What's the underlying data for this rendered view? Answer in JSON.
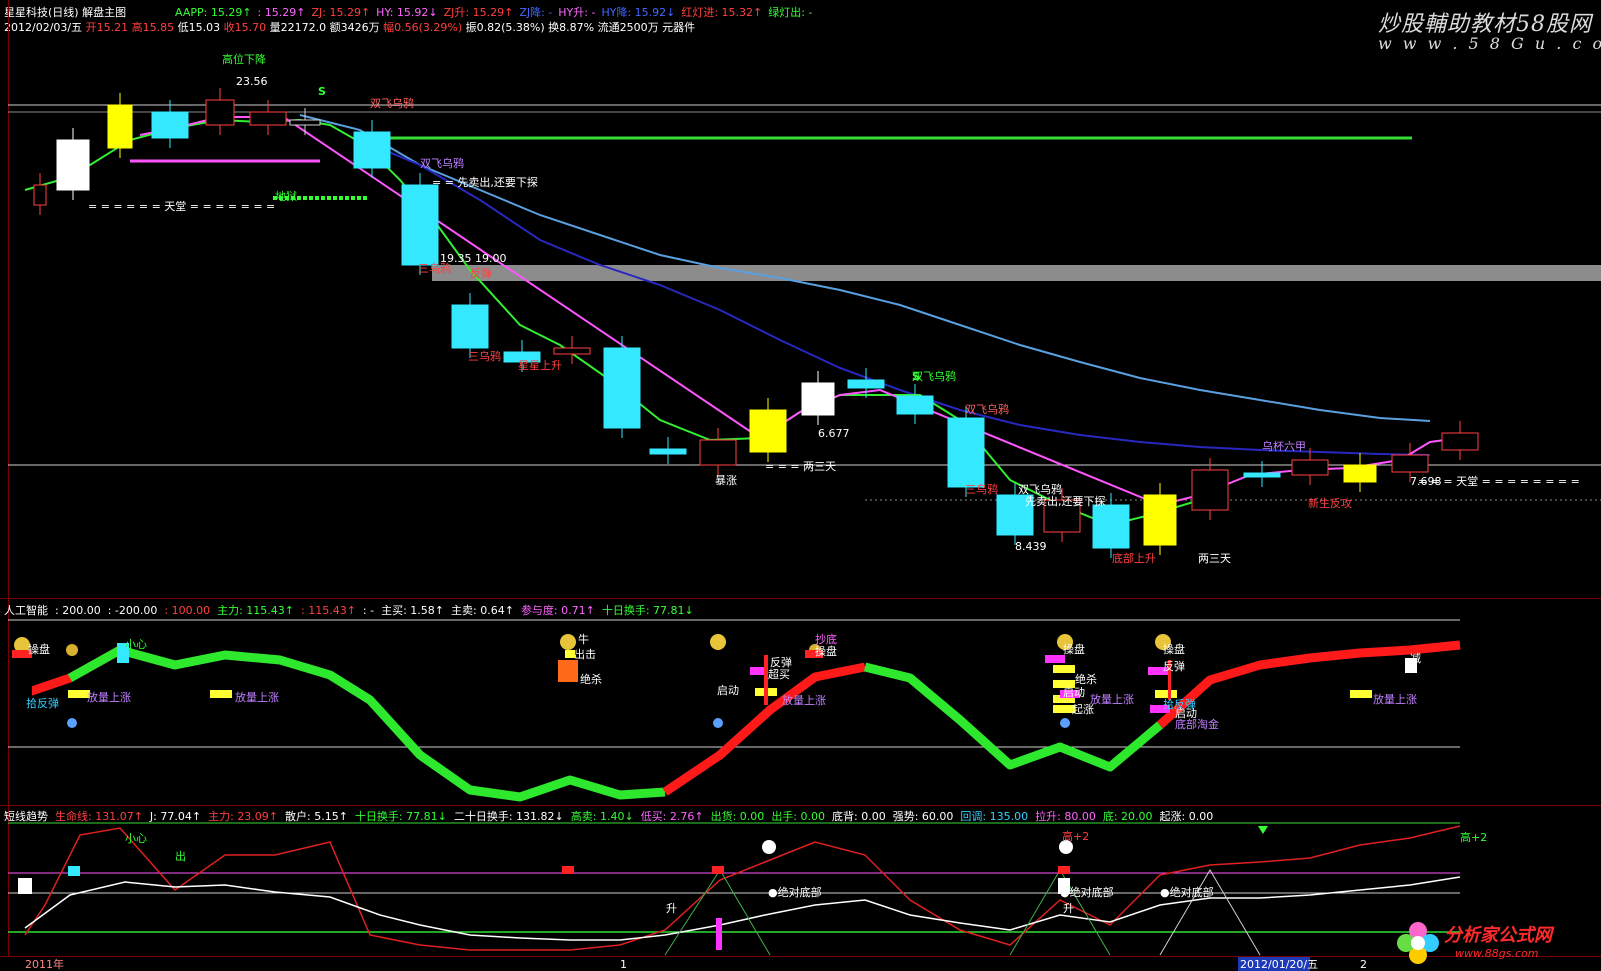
{
  "header": {
    "title": "星星科技(日线)",
    "subtitle": "解盘主图",
    "indicators1": [
      {
        "label": "AAPP: 15.29",
        "arrow": "↑",
        "color": "#33ff33"
      },
      {
        "label": ": 15.29",
        "arrow": "↑",
        "color": "#ff66ff"
      },
      {
        "label": "ZJ: 15.29",
        "arrow": "↑",
        "color": "#ff4040"
      },
      {
        "label": "HY: 15.92",
        "arrow": "↓",
        "color": "#ff66ff"
      },
      {
        "label": "ZJ升: 15.29",
        "arrow": "↑",
        "color": "#ff4040"
      },
      {
        "label": "ZJ降: -",
        "arrow": "",
        "color": "#4466ff"
      },
      {
        "label": "HY升: -",
        "arrow": "",
        "color": "#ff66ff"
      },
      {
        "label": "HY降: 15.92",
        "arrow": "↓",
        "color": "#4466ff"
      },
      {
        "label": "红灯进: 15.32",
        "arrow": "↑",
        "color": "#ff4040"
      },
      {
        "label": "绿灯出: -",
        "arrow": "",
        "color": "#33ff33"
      }
    ],
    "ohlc": {
      "date": "2012/02/03/五",
      "open": "开15.21",
      "high": "高15.85",
      "low": "低15.03",
      "close": "收15.70",
      "volume": "量22172.0",
      "amount": "额3426万",
      "change": "幅0.56(3.29%)",
      "amplitude": "振0.82(5.38%)",
      "turnover": "换8.87%",
      "float": "流通2500万",
      "sector": "元器件"
    }
  },
  "watermarks": {
    "top_cn": "炒股輔助教材58股网",
    "top_url": "w w w . 5 8 G u . c o m",
    "bottom_cn": "分析家公式网",
    "bottom_url": "www.88gs.com"
  },
  "main_chart": {
    "price_labels": {
      "high_mark": "23.56",
      "gap_levels": "19.35 19.00",
      "mid_low": "6.677",
      "low1": "8.439",
      "low2": "7.698"
    },
    "annotations": [
      "高位下降",
      "S",
      "双飞乌鸦",
      "双飞乌鸦",
      "= = 先卖出,还要下探",
      "= = = = = = 天堂 = = = = = = =",
      "地狱",
      "三乌鸦",
      "反弹",
      "三乌鸦",
      "星星上升",
      "暴涨",
      "= = = 两三天",
      "双飞乌鸦",
      "S",
      "双飞乌鸦",
      "三乌鸦",
      "双飞乌鸦",
      "先卖出,还要下探",
      "底部上升",
      "两三天",
      "乌杯六甲",
      "新生反攻",
      "= = = 天堂 = = = = = = = ="
    ]
  },
  "panel2": {
    "indicators": [
      {
        "label": "人工智能",
        "color": "#ffffff"
      },
      {
        "label": ": 200.00",
        "color": "#ffffff"
      },
      {
        "label": ": -200.00",
        "color": "#ffffff"
      },
      {
        "label": ": 100.00",
        "color": "#ff4040"
      },
      {
        "label": "主力: 115.43",
        "arrow": "↑",
        "color": "#33ff33"
      },
      {
        "label": ": 115.43",
        "arrow": "↑",
        "color": "#ff4040"
      },
      {
        "label": ": -",
        "color": "#ffffff"
      },
      {
        "label": "主买: 1.58",
        "arrow": "↑",
        "color": "#ffffff"
      },
      {
        "label": "主卖: 0.64",
        "arrow": "↑",
        "color": "#ffffff"
      },
      {
        "label": "参与度: 0.71",
        "arrow": "↑",
        "color": "#ff66ff"
      },
      {
        "label": "十日换手: 77.81",
        "arrow": "↓",
        "color": "#33ff33"
      }
    ],
    "labels": [
      "操盘",
      "小心",
      "拾反弹",
      "放量上涨",
      "放量上涨",
      "牛",
      "出击",
      "绝杀",
      "启动",
      "反弹",
      "超买",
      "放量上涨",
      "抄底",
      "操盘",
      "操盘",
      "绝杀",
      "启动",
      "起涨",
      "放量上涨",
      "操盘",
      "反弹",
      "拾反弹",
      "启动",
      "底部淘金",
      "放量上涨",
      "减"
    ]
  },
  "panel3": {
    "indicators": [
      {
        "label": "短线趋势",
        "color": "#ffffff"
      },
      {
        "label": "生命线: 131.07",
        "arrow": "↑",
        "color": "#ff4040"
      },
      {
        "label": "J: 77.04",
        "arrow": "↑",
        "color": "#ffffff"
      },
      {
        "label": "主力: 23.09",
        "arrow": "↑",
        "color": "#ff4040"
      },
      {
        "label": "散户: 5.15",
        "arrow": "↑",
        "color": "#ffffff"
      },
      {
        "label": "十日换手: 77.81",
        "arrow": "↓",
        "color": "#33ff33"
      },
      {
        "label": "二十日换手: 131.82",
        "arrow": "↓",
        "color": "#ffffff"
      },
      {
        "label": "高卖: 1.40",
        "arrow": "↓",
        "color": "#33ff33"
      },
      {
        "label": "低买: 2.76",
        "arrow": "↑",
        "color": "#ff66ff"
      },
      {
        "label": "出货: 0.00",
        "color": "#33ff33"
      },
      {
        "label": "出手: 0.00",
        "color": "#33ff33"
      },
      {
        "label": "底背: 0.00",
        "color": "#ffffff"
      },
      {
        "label": "强势: 60.00",
        "color": "#ffffff"
      },
      {
        "label": "回调: 135.00",
        "color": "#35d0ff"
      },
      {
        "label": "拉升: 80.00",
        "color": "#ff66ff"
      },
      {
        "label": "底: 20.00",
        "color": "#33ff33"
      },
      {
        "label": "起涨: 0.00",
        "color": "#ffffff"
      }
    ],
    "labels": [
      "小心",
      "出",
      "升",
      "●绝对底部",
      "高+2",
      "●绝对底部",
      "升",
      "●绝对底部",
      "高+2"
    ]
  },
  "timeline": {
    "labels": [
      "2011年",
      "1",
      "2012/01/20/五",
      "2"
    ]
  }
}
